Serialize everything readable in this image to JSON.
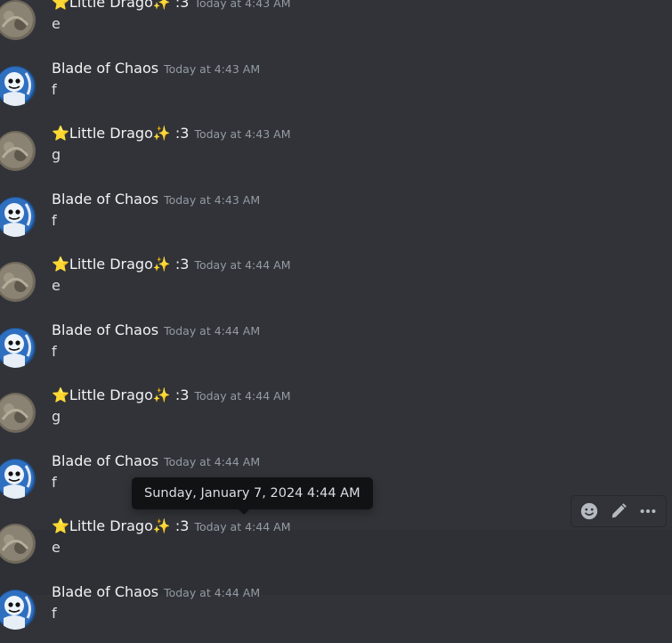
{
  "users": {
    "dragon": {
      "name": "⭐Little Drago✨ :3",
      "avatar": "dragon-avatar-icon"
    },
    "blade": {
      "name": "Blade of Chaos",
      "avatar": "blade-avatar-icon"
    }
  },
  "messages": [
    {
      "author": "⭐Little Drago✨ :3",
      "time": "Today at 4:43 AM",
      "text": "e"
    },
    {
      "author": "Blade of Chaos",
      "time": "Today at 4:43 AM",
      "text": "f"
    },
    {
      "author": "⭐Little Drago✨ :3",
      "time": "Today at 4:43 AM",
      "text": "g"
    },
    {
      "author": "Blade of Chaos",
      "time": "Today at 4:43 AM",
      "text": "f"
    },
    {
      "author": "⭐Little Drago✨ :3",
      "time": "Today at 4:44 AM",
      "text": "e"
    },
    {
      "author": "Blade of Chaos",
      "time": "Today at 4:44 AM",
      "text": "f"
    },
    {
      "author": "⭐Little Drago✨ :3",
      "time": "Today at 4:44 AM",
      "text": "g"
    },
    {
      "author": "Blade of Chaos",
      "time": "Today at 4:44 AM",
      "text": "f"
    },
    {
      "author": "⭐Little Drago✨ :3",
      "time": "Today at 4:44 AM",
      "text": "e"
    },
    {
      "author": "Blade of Chaos",
      "time": "Today at 4:44 AM",
      "text": "f"
    }
  ],
  "tooltip": {
    "text": "Sunday, January 7, 2024 4:44 AM"
  },
  "hover_actions": [
    {
      "icon": "add-reaction-icon"
    },
    {
      "icon": "edit-pencil-icon"
    },
    {
      "icon": "more-options-icon"
    }
  ],
  "colors": {
    "background": "#313338",
    "hover_background": "#2e3035",
    "username": "#f2f3f5",
    "timestamp": "#949ba4",
    "text": "#dbdee1",
    "tooltip_bg": "#111214"
  }
}
